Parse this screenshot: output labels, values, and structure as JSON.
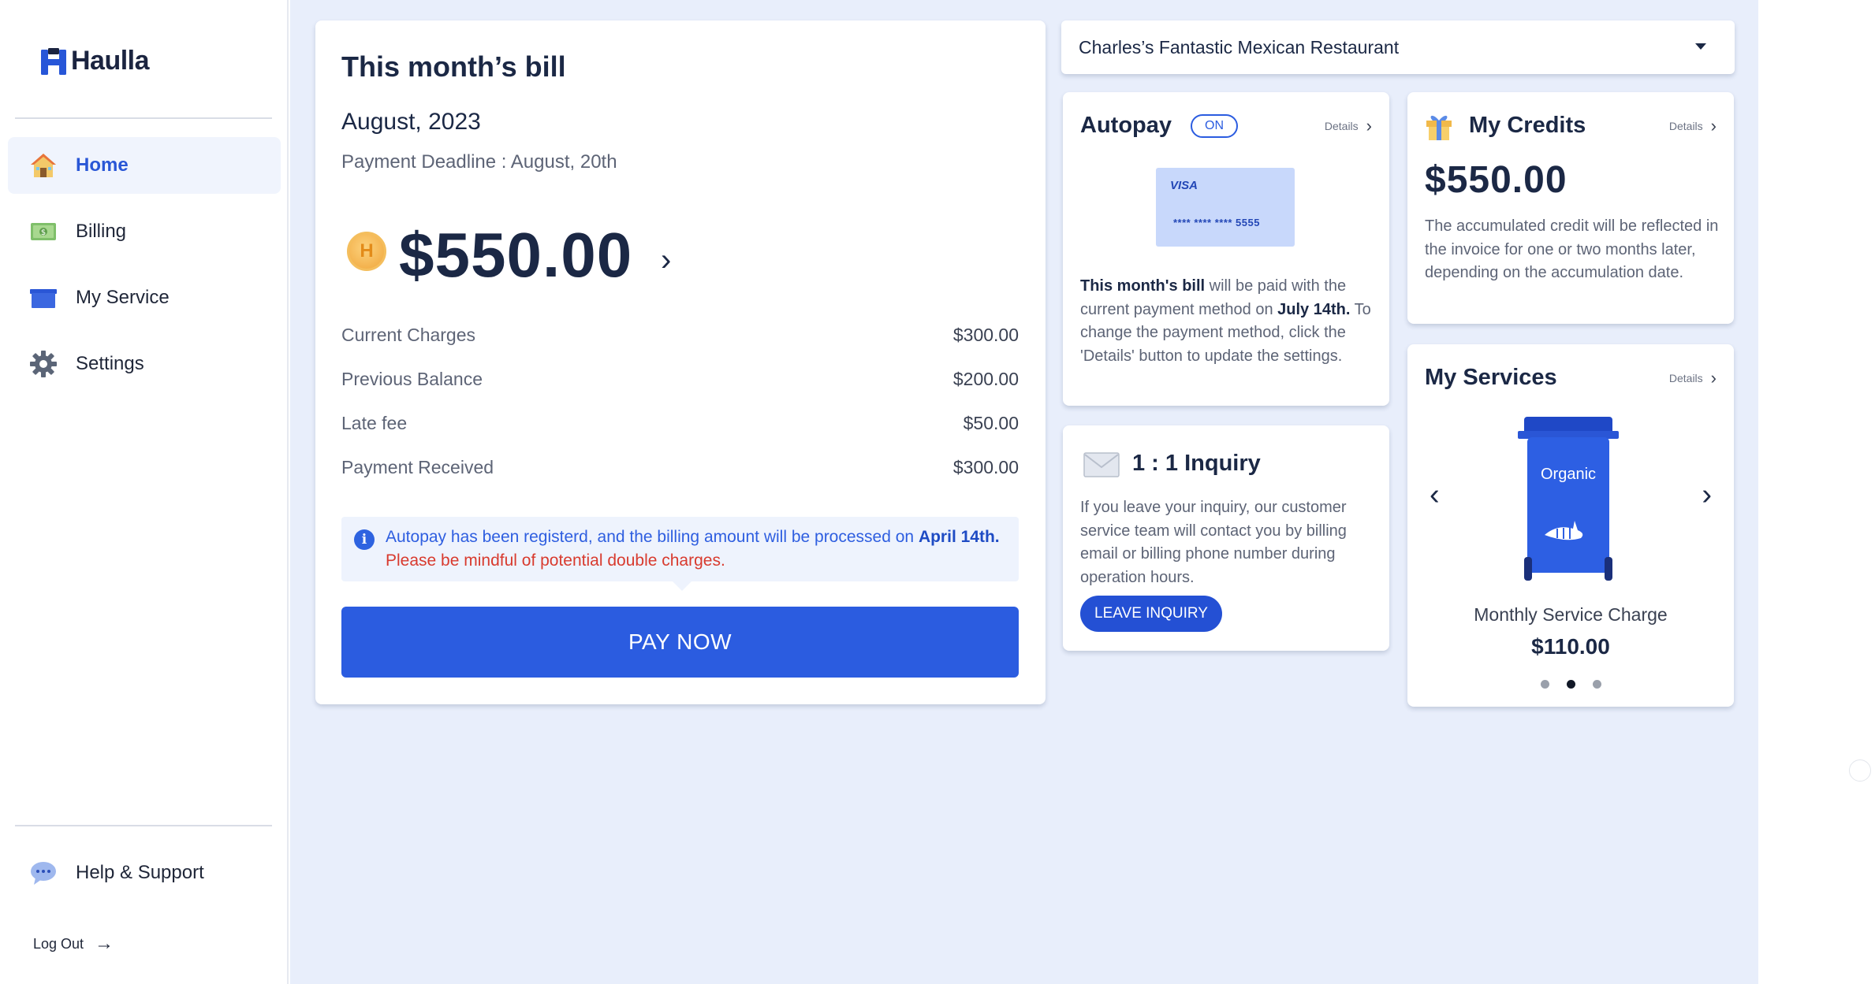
{
  "brand": {
    "name": "Haulla"
  },
  "sidebar": {
    "items": [
      {
        "label": "Home",
        "icon": "house-icon",
        "active": true
      },
      {
        "label": "Billing",
        "icon": "cash-icon",
        "active": false
      },
      {
        "label": "My Service",
        "icon": "bin-icon",
        "active": false
      },
      {
        "label": "Settings",
        "icon": "gear-icon",
        "active": false
      }
    ],
    "help_label": "Help & Support",
    "logout_label": "Log Out"
  },
  "bill": {
    "title": "This month’s bill",
    "month": "August, 2023",
    "deadline": "Payment Deadline : August, 20th",
    "coin_letter": "H",
    "amount": "$550.00",
    "lines": [
      {
        "label": "Current Charges",
        "value": "$300.00"
      },
      {
        "label": "Previous Balance",
        "value": "$200.00"
      },
      {
        "label": "Late fee",
        "value": "$50.00"
      },
      {
        "label": "Payment Received",
        "value": "$300.00"
      }
    ],
    "notice_prefix": "Autopay has been registerd, and the billing amount will be processed on ",
    "notice_date": "April 14th.",
    "notice_warning": "Please be mindful of potential double charges.",
    "pay_button": "PAY NOW"
  },
  "restaurant_select": {
    "value": "Charles’s Fantastic Mexican Restaurant"
  },
  "autopay": {
    "title": "Autopay",
    "status": "ON",
    "details_label": "Details",
    "card_brand": "VISA",
    "card_number": "**** **** **** 5555",
    "text_bold1": "This month's bill",
    "text_mid": " will be paid with the current payment method on ",
    "text_bold2": "July 14th.",
    "text_end": " To change the payment method, click the 'Details' button to update the settings."
  },
  "credits": {
    "title": "My Credits",
    "details_label": "Details",
    "amount": "$550.00",
    "description": "The accumulated credit will be reflected in the invoice for one or two months later, depending on the accumulation date."
  },
  "inquiry": {
    "title": "1 : 1 Inquiry",
    "description": "If you leave your inquiry, our customer service team will contact you by billing email or billing phone number during operation hours.",
    "button": "LEAVE INQUIRY"
  },
  "services": {
    "title": "My Services",
    "details_label": "Details",
    "bin_label": "Organic",
    "service_name": "Monthly Service Charge",
    "price": "$110.00",
    "carousel_total": 3,
    "carousel_active": 2
  },
  "colors": {
    "primary": "#2b5ce0",
    "background": "#e8eefb",
    "warning": "#d83a2e",
    "text_dark": "#1b2845"
  }
}
